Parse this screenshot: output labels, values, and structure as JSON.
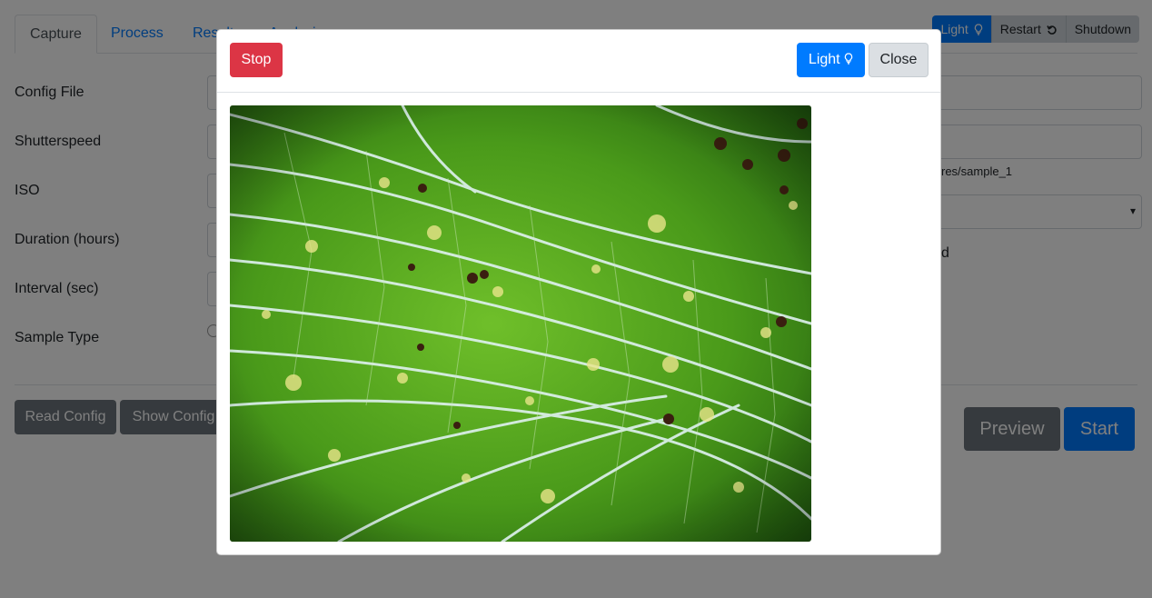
{
  "tabs": [
    {
      "label": "Capture"
    },
    {
      "label": "Process"
    },
    {
      "label": "Results"
    },
    {
      "label": "Analysis"
    }
  ],
  "top_buttons": {
    "light": "Light",
    "restart": "Restart",
    "shutdown": "Shutdown"
  },
  "form": {
    "config_file_label": "Config File",
    "shutterspeed_label": "Shutterspeed",
    "iso_label": "ISO",
    "duration_label": "Duration (hours)",
    "interval_label": "Interval (sec)",
    "sample_type_label": "Sample Type",
    "path_hint": "res/sample_1",
    "partial_right_text": "d",
    "select_arrow": "▾"
  },
  "actions": {
    "read_config": "Read Config",
    "show_config": "Show Config",
    "preview": "Preview",
    "start": "Start"
  },
  "modal": {
    "stop": "Stop",
    "light": "Light",
    "close": "Close",
    "image_subject": "leaf-microscopy-image"
  },
  "colors": {
    "primary": "#007bff",
    "danger": "#dc3545",
    "secondary": "#6c757d",
    "leaf_green": "#4a9a1a"
  }
}
